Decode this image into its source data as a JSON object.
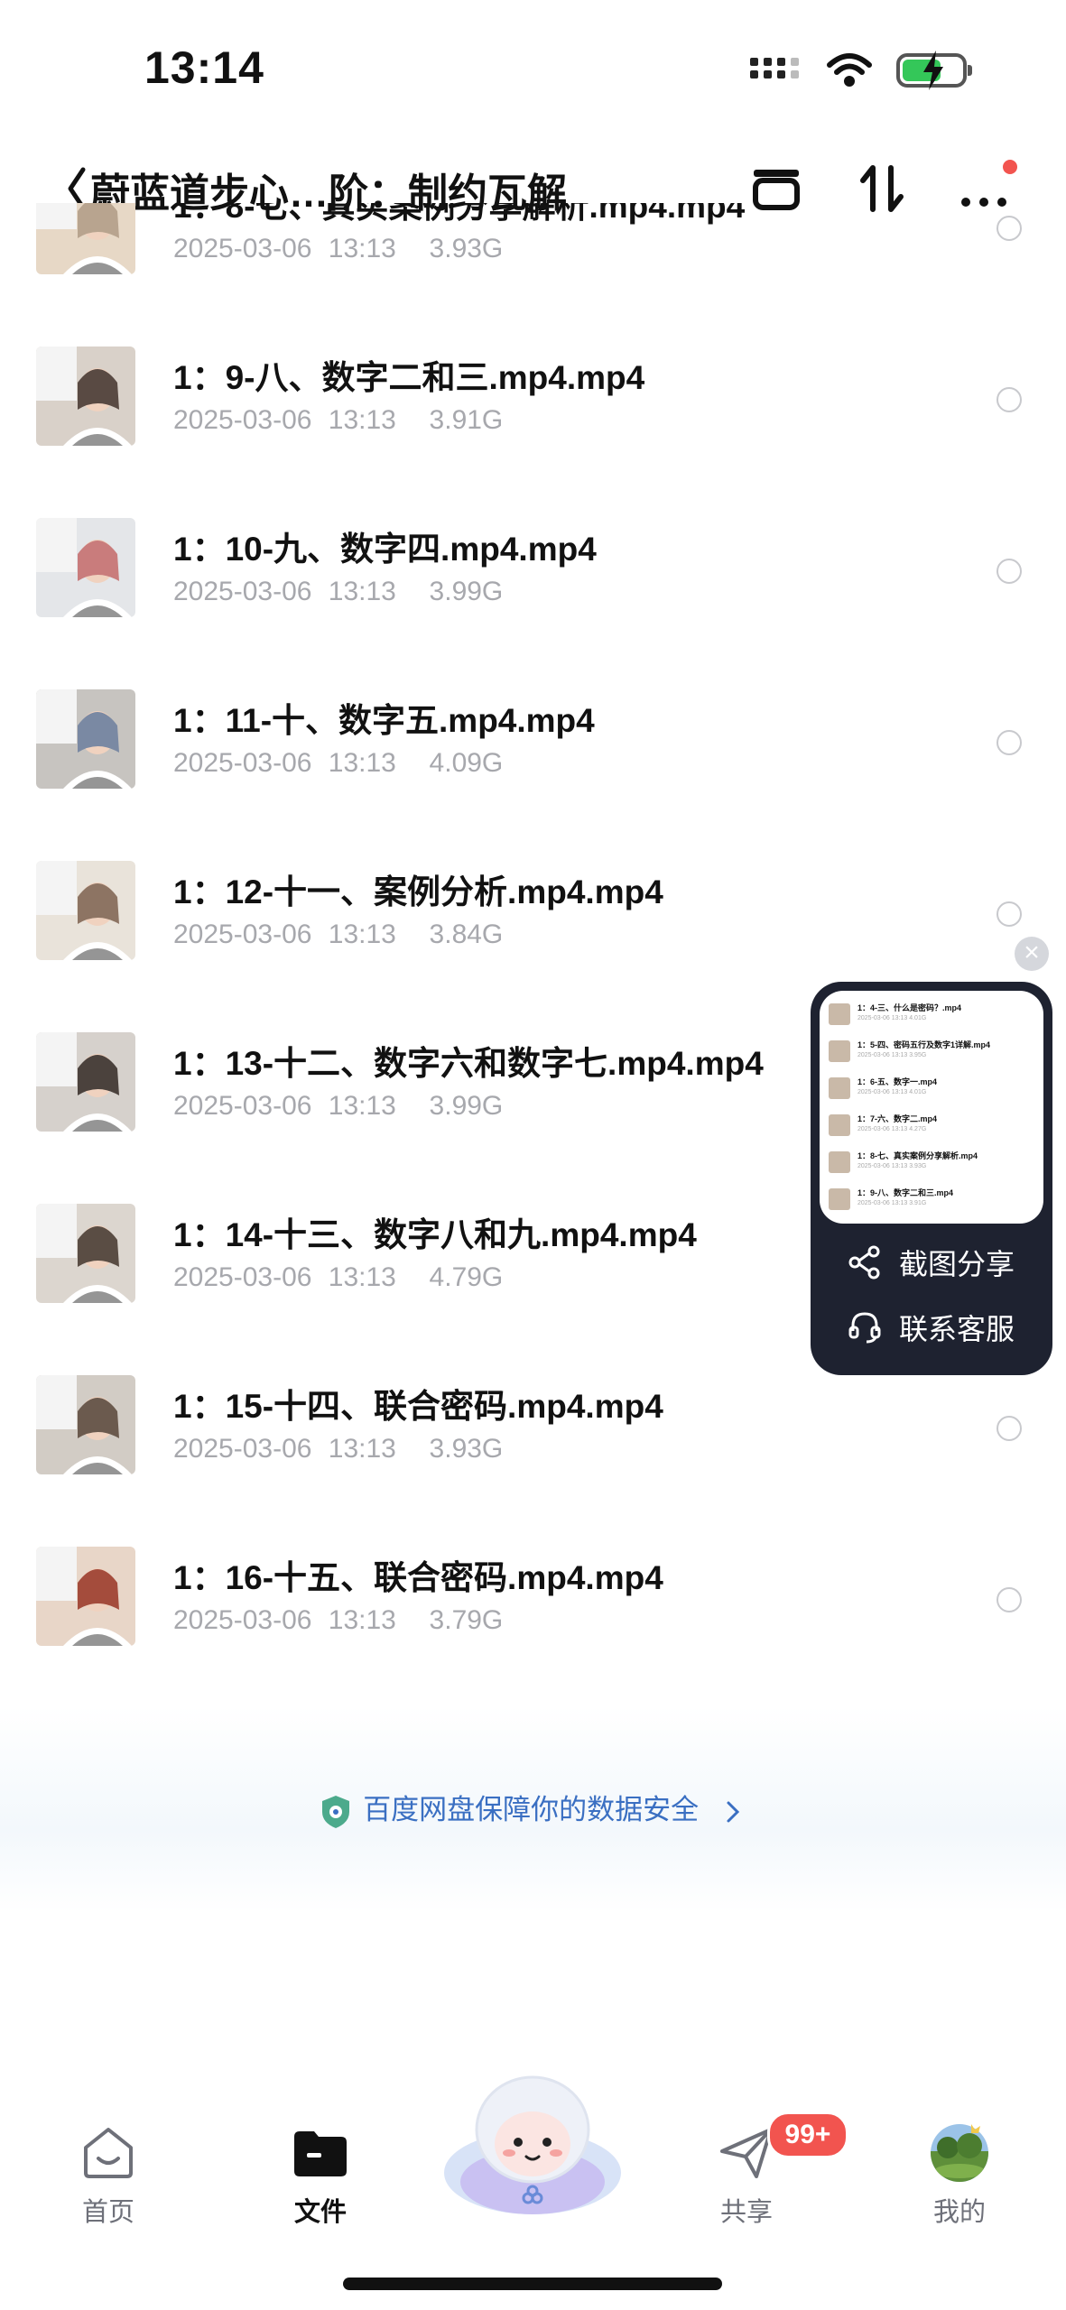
{
  "status": {
    "time": "13:14"
  },
  "header": {
    "title": "蔚蓝道步心…阶：制约瓦解"
  },
  "files": [
    {
      "name": "1：8-七、真实案例分享解析.mp4.mp4",
      "date": "2025-03-06 13:13",
      "size": "3.93G"
    },
    {
      "name": "1：9-八、数字二和三.mp4.mp4",
      "date": "2025-03-06 13:13",
      "size": "3.91G"
    },
    {
      "name": "1：10-九、数字四.mp4.mp4",
      "date": "2025-03-06 13:13",
      "size": "3.99G"
    },
    {
      "name": "1：11-十、数字五.mp4.mp4",
      "date": "2025-03-06 13:13",
      "size": "4.09G"
    },
    {
      "name": "1：12-十一、案例分析.mp4.mp4",
      "date": "2025-03-06 13:13",
      "size": "3.84G"
    },
    {
      "name": "1：13-十二、数字六和数字七.mp4.mp4",
      "date": "2025-03-06 13:13",
      "size": "3.99G"
    },
    {
      "name": "1：14-十三、数字八和九.mp4.mp4",
      "date": "2025-03-06 13:13",
      "size": "4.79G"
    },
    {
      "name": "1：15-十四、联合密码.mp4.mp4",
      "date": "2025-03-06 13:13",
      "size": "3.93G"
    },
    {
      "name": "1：16-十五、联合密码.mp4.mp4",
      "date": "2025-03-06 13:13",
      "size": "3.79G"
    }
  ],
  "security_banner": "百度网盘保障你的数据安全",
  "float_panel": {
    "preview_rows": [
      {
        "name": "1：4-三、什么是密码？.mp4",
        "meta": "2025-03-06 13:13  4.01G"
      },
      {
        "name": "1：5-四、密码五行及数字1详解.mp4",
        "meta": "2025-03-06 13:13  3.95G"
      },
      {
        "name": "1：6-五、数字一.mp4",
        "meta": "2025-03-06 13:13  4.01G"
      },
      {
        "name": "1：7-六、数字二.mp4",
        "meta": "2025-03-06 13:13  4.27G"
      },
      {
        "name": "1：8-七、真实案例分享解析.mp4",
        "meta": "2025-03-06 13:13  3.93G"
      },
      {
        "name": "1：9-八、数字二和三.mp4",
        "meta": "2025-03-06 13:13  3.91G"
      }
    ],
    "share_label": "截图分享",
    "support_label": "联系客服",
    "close_glyph": "×"
  },
  "tabs": [
    {
      "label": "首页",
      "icon": "home-icon"
    },
    {
      "label": "文件",
      "icon": "folder-icon"
    },
    {
      "label": "共享",
      "icon": "send-icon"
    },
    {
      "label": "我的",
      "icon": "avatar"
    }
  ],
  "share_badge": "99+",
  "colors": {
    "accent": "#3a6fc2",
    "badge": "#f2544f",
    "panel": "#1e2230",
    "meta": "#a7a8ad"
  }
}
